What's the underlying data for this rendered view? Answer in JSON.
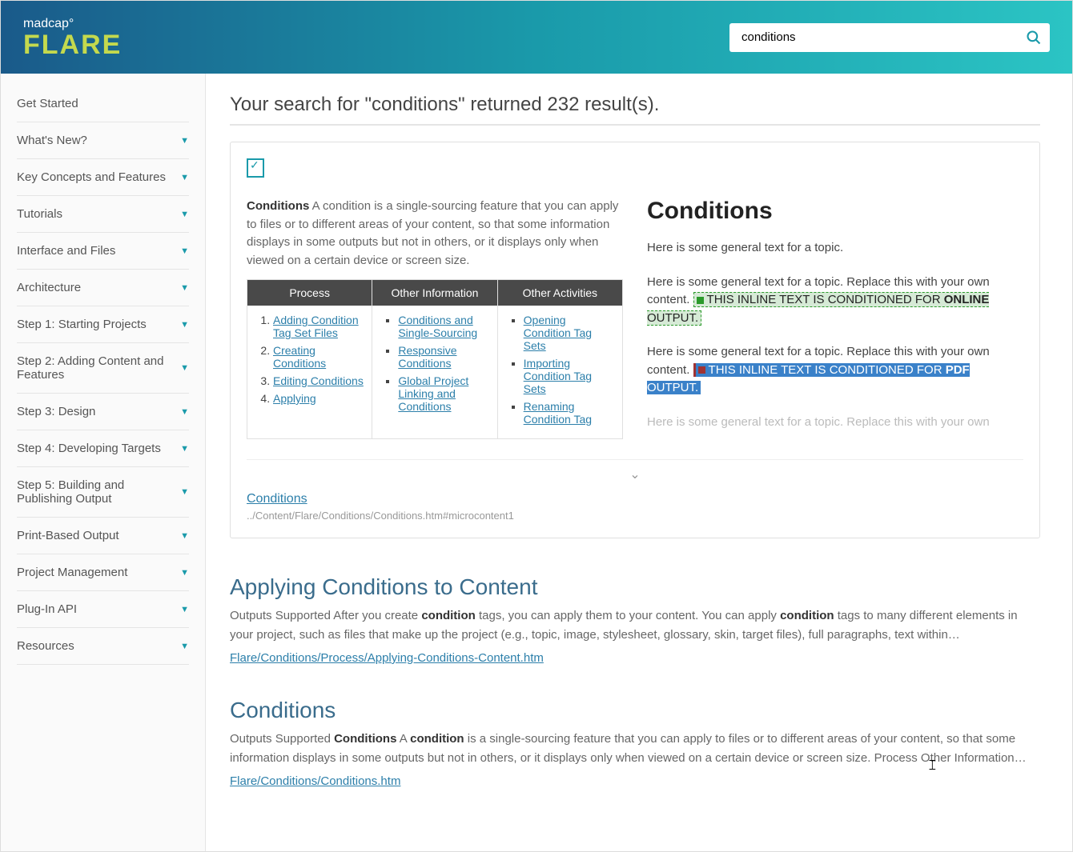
{
  "brand": {
    "top": "madcap°",
    "bottom": "FLARE"
  },
  "search": {
    "value": "conditions",
    "placeholder": "Search"
  },
  "sidebar": {
    "items": [
      {
        "label": "Get Started",
        "chevron": false
      },
      {
        "label": "What's New?",
        "chevron": true
      },
      {
        "label": "Key Concepts and Features",
        "chevron": true
      },
      {
        "label": "Tutorials",
        "chevron": true
      },
      {
        "label": "Interface and Files",
        "chevron": true
      },
      {
        "label": "Architecture",
        "chevron": true
      },
      {
        "label": "Step 1: Starting Projects",
        "chevron": true
      },
      {
        "label": "Step 2: Adding Content and Features",
        "chevron": true
      },
      {
        "label": "Step 3: Design",
        "chevron": true
      },
      {
        "label": "Step 4: Developing Targets",
        "chevron": true
      },
      {
        "label": "Step 5: Building and Publishing Output",
        "chevron": true
      },
      {
        "label": "Print-Based Output",
        "chevron": true
      },
      {
        "label": "Project Management",
        "chevron": true
      },
      {
        "label": "Plug-In API",
        "chevron": true
      },
      {
        "label": "Resources",
        "chevron": true
      }
    ]
  },
  "summary": "Your search for \"conditions\" returned 232 result(s).",
  "card": {
    "desc_bold": "Conditions",
    "desc": " A condition is a single-sourcing feature that you can apply to files or to different areas of your content, so that some information displays in some outputs but not in others, or it displays only when viewed on a certain device or screen size.",
    "col1_head": "Process",
    "col2_head": "Other Information",
    "col3_head": "Other Activities",
    "process": [
      "Adding Condition Tag Set Files",
      "Creating Conditions",
      "Editing Conditions",
      "Applying"
    ],
    "other_info": [
      "Conditions and Single-Sourcing",
      "Responsive Conditions",
      "Global Project Linking and Conditions"
    ],
    "other_act": [
      "Opening Condition Tag Sets",
      "Importing Condition Tag Sets",
      "Renaming Condition Tag"
    ],
    "preview_title": "Conditions",
    "preview_p1": "Here is some general text for a topic.",
    "preview_p2a": "Here is some general text for a topic. Replace this with your own content. ",
    "preview_inline1": "THIS INLINE TEXT IS CONDITIONED FOR ",
    "preview_inline1b": "ONLINE",
    "preview_inline1c": " OUTPUT.",
    "preview_p3a": "Here is some general text for a topic. Replace this with your own content. ",
    "preview_inline2": "THIS INLINE TEXT IS CONDITIONED FOR ",
    "preview_inline2b": "PDF",
    "preview_inline2c": " OUTPUT.",
    "preview_p4": "Here is some general text for a topic. Replace this with your own",
    "link_text": "Conditions",
    "link_path": "../Content/Flare/Conditions/Conditions.htm#microcontent1"
  },
  "results": [
    {
      "title_pre": "Applying ",
      "title_b": "Conditions",
      "title_post": " to Content",
      "snippet_pre": "Outputs Supported After you create ",
      "snippet_b1": "condition",
      "snippet_mid": " tags, you can apply them to your content. You can apply ",
      "snippet_b2": "condition",
      "snippet_post": " tags to many different elements in your project, such as files that make up the project (e.g., topic, image, stylesheet, glossary, skin, target files), full paragraphs, text within…",
      "path": "Flare/Conditions/Process/Applying-Conditions-Content.htm"
    },
    {
      "title_pre": "",
      "title_b": "Conditions",
      "title_post": "",
      "snippet_pre": "Outputs Supported ",
      "snippet_b1": "Conditions",
      "snippet_mid": " A ",
      "snippet_b2": "condition",
      "snippet_post": " is a single-sourcing feature that you can apply to files or to different areas of your content, so that some information displays in some outputs but not in others, or it displays only when viewed on a certain device or screen size. Process Other Information…",
      "path": "Flare/Conditions/Conditions.htm"
    }
  ]
}
